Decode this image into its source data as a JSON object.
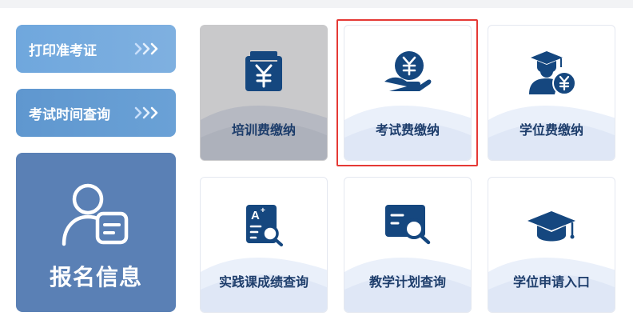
{
  "sidebar": {
    "print_ticket": "打印准考证",
    "exam_time": "考试时间查询",
    "registration": "报名信息"
  },
  "tiles": [
    {
      "label": "培训费缴纳",
      "icon": "yuan-card-icon",
      "state": "disabled"
    },
    {
      "label": "考试费缴纳",
      "icon": "hand-yuan-coin-icon",
      "state": "selected"
    },
    {
      "label": "学位费缴纳",
      "icon": "graduate-yuan-icon",
      "state": "normal"
    },
    {
      "label": "实践课成绩查询",
      "icon": "grade-report-search-icon",
      "state": "normal"
    },
    {
      "label": "教学计划查询",
      "icon": "plan-search-icon",
      "state": "normal"
    },
    {
      "label": "学位申请入口",
      "icon": "mortarboard-icon",
      "state": "normal"
    }
  ],
  "colors": {
    "icon_blue": "#15477f",
    "label_navy": "#1d3d6b",
    "big_card": "#5a80b5",
    "highlight": "#e53935"
  }
}
